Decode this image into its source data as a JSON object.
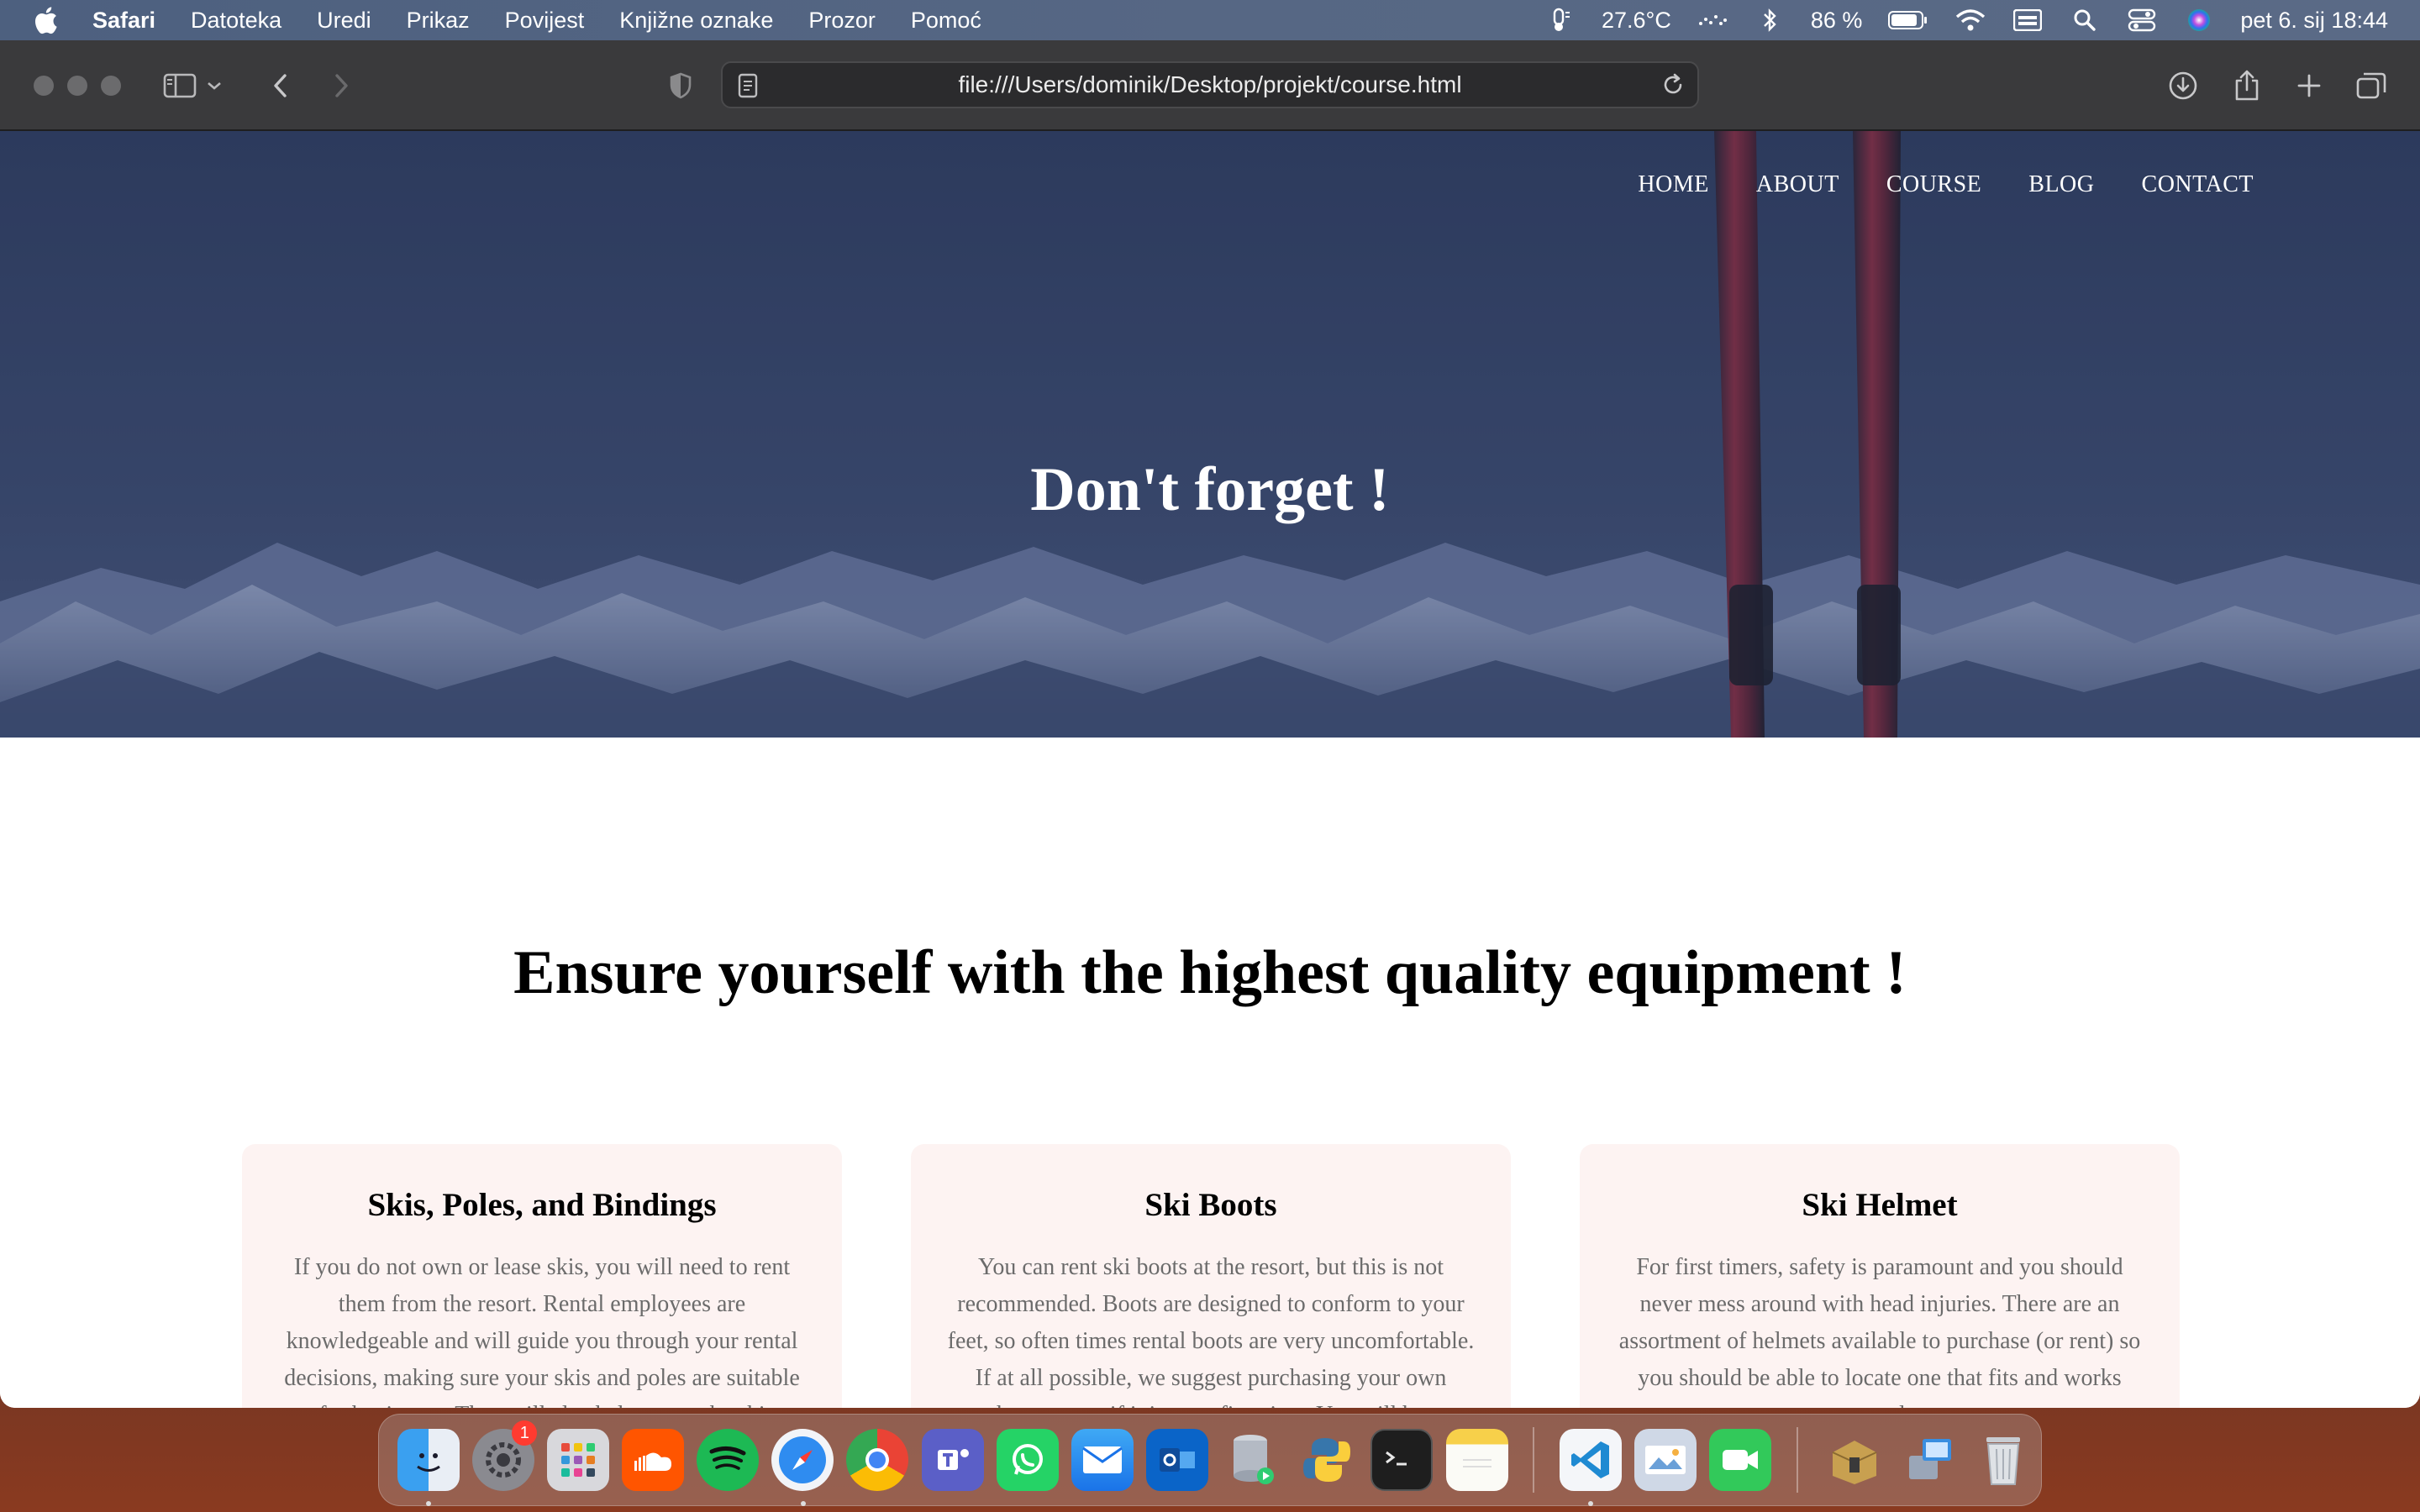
{
  "menubar": {
    "app_name": "Safari",
    "items": [
      "Datoteka",
      "Uredi",
      "Prikaz",
      "Povijest",
      "Knjižne oznake",
      "Prozor",
      "Pomoć"
    ],
    "temperature": "27.6°C",
    "battery": "86 %",
    "datetime": "pet 6. sij  18:44"
  },
  "browser": {
    "url": "file:///Users/dominik/Desktop/projekt/course.html"
  },
  "site": {
    "nav": [
      "HOME",
      "ABOUT",
      "COURSE",
      "BLOG",
      "CONTACT"
    ],
    "hero_title": "Don't forget !",
    "section_title": "Ensure yourself with the highest quality equipment !",
    "cards": [
      {
        "title": "Skis, Poles, and Bindings",
        "text": "If you do not own or lease skis, you will need to rent them from the resort. Rental employees are knowledgeable and will guide you through your rental decisions, making sure your skis and poles are suitable for beginners. They will also help set up the ski"
      },
      {
        "title": "Ski Boots",
        "text": "You can rent ski boots at the resort, but this is not recommended. Boots are designed to conform to your feet, so often times rental boots are very uncomfortable. If at all possible, we suggest purchasing your own boots, even if it is your first time. You will be"
      },
      {
        "title": "Ski Helmet",
        "text": "For first timers, safety is paramount and you should never mess around with head injuries. There are an assortment of helmets available to purchase (or rent) so you should be able to locate one that fits and works properly."
      }
    ]
  },
  "dock": {
    "settings_badge": "1"
  },
  "colors": {
    "accent_menubar": "#566784",
    "card_bg": "#fdf3f2",
    "hero_overlay": "#34426a"
  }
}
